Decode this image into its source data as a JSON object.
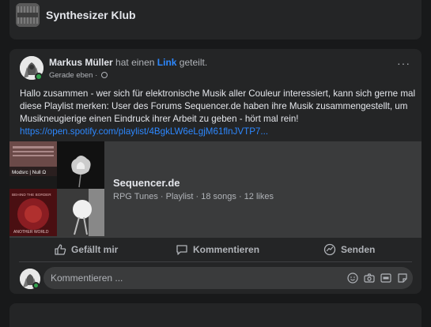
{
  "group": {
    "name": "Synthesizer Klub"
  },
  "post": {
    "author": "Markus Müller",
    "action_prefix": "hat einen",
    "action_link": "Link",
    "action_suffix": "geteilt.",
    "time": "Gerade eben ·",
    "more": "···",
    "text": "Hallo zusammen - wer sich für elektronische Musik aller Couleur interessiert, kann sich gerne mal diese Playlist merken: User des Forums Sequencer.de haben ihre Musik zusammengestellt, um Musikneugierige einen Eindruck ihrer Arbeit zu geben - hört mal rein!",
    "url": "https://open.spotify.com/playlist/4BgkLW6eLgjM61flnJVTP7...",
    "attachment": {
      "title": "Sequencer.de",
      "subtitle": "RPG Tunes · Playlist · 18 songs · 12 likes",
      "thumb_labels": {
        "tl": "Modsrc | Null Ω",
        "bl_top": "BEHIND THE BORDER",
        "bl_bottom": "ANOTHER WORLD"
      }
    }
  },
  "actions": {
    "like": "Gefällt mir",
    "comment": "Kommentieren",
    "send": "Senden"
  },
  "comment": {
    "placeholder": "Kommentieren ..."
  },
  "colors": {
    "accent": "#2d88ff",
    "online": "#31a24c",
    "card": "#242526",
    "background": "#18191a"
  }
}
